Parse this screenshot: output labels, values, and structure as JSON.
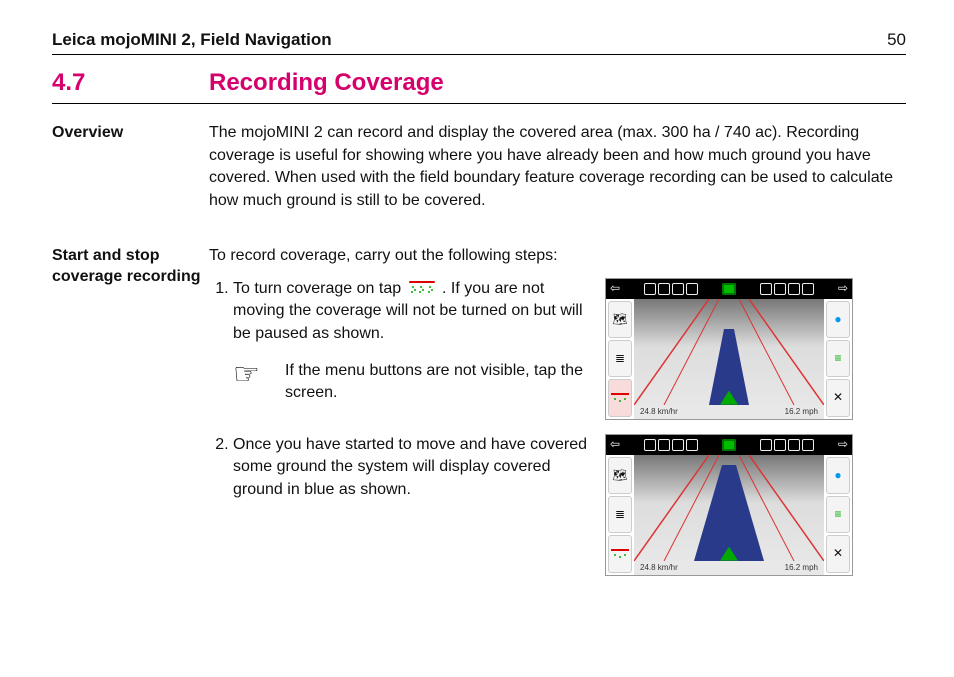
{
  "header": {
    "doc_title": "Leica mojoMINI 2, Field Navigation",
    "page_number": "50"
  },
  "section": {
    "number": "4.7",
    "title": "Recording Coverage"
  },
  "overview": {
    "label": "Overview",
    "text": "The mojoMINI 2 can record and display the covered area (max. 300 ha / 740 ac). Recording coverage is useful for showing where you have already been and how much ground you have covered. When used with the field boundary feature coverage recording can be used to calculate how much ground is still to be covered."
  },
  "procedure": {
    "label": "Start and stop coverage recording",
    "intro": "To record coverage, carry out the following steps:",
    "steps": [
      {
        "pre": "To turn coverage on tap ",
        "post": ". If you are not moving the coverage will not be turned on but will be paused as shown.",
        "note": "If the menu buttons are not visible, tap the screen.",
        "screenshot": {
          "speed_l": "24.8 km/hr",
          "speed_r": "16.2 mph",
          "mode": "paused"
        }
      },
      {
        "text": "Once you have started to move and have covered some ground the system will display covered ground in blue as shown.",
        "screenshot": {
          "speed_l": "24.8 km/hr",
          "speed_r": "16.2 mph",
          "mode": "recording"
        }
      }
    ]
  },
  "icons": {
    "coverage_tap": "coverage-spray-icon",
    "pointing_hand": "pointing-hand-icon"
  }
}
